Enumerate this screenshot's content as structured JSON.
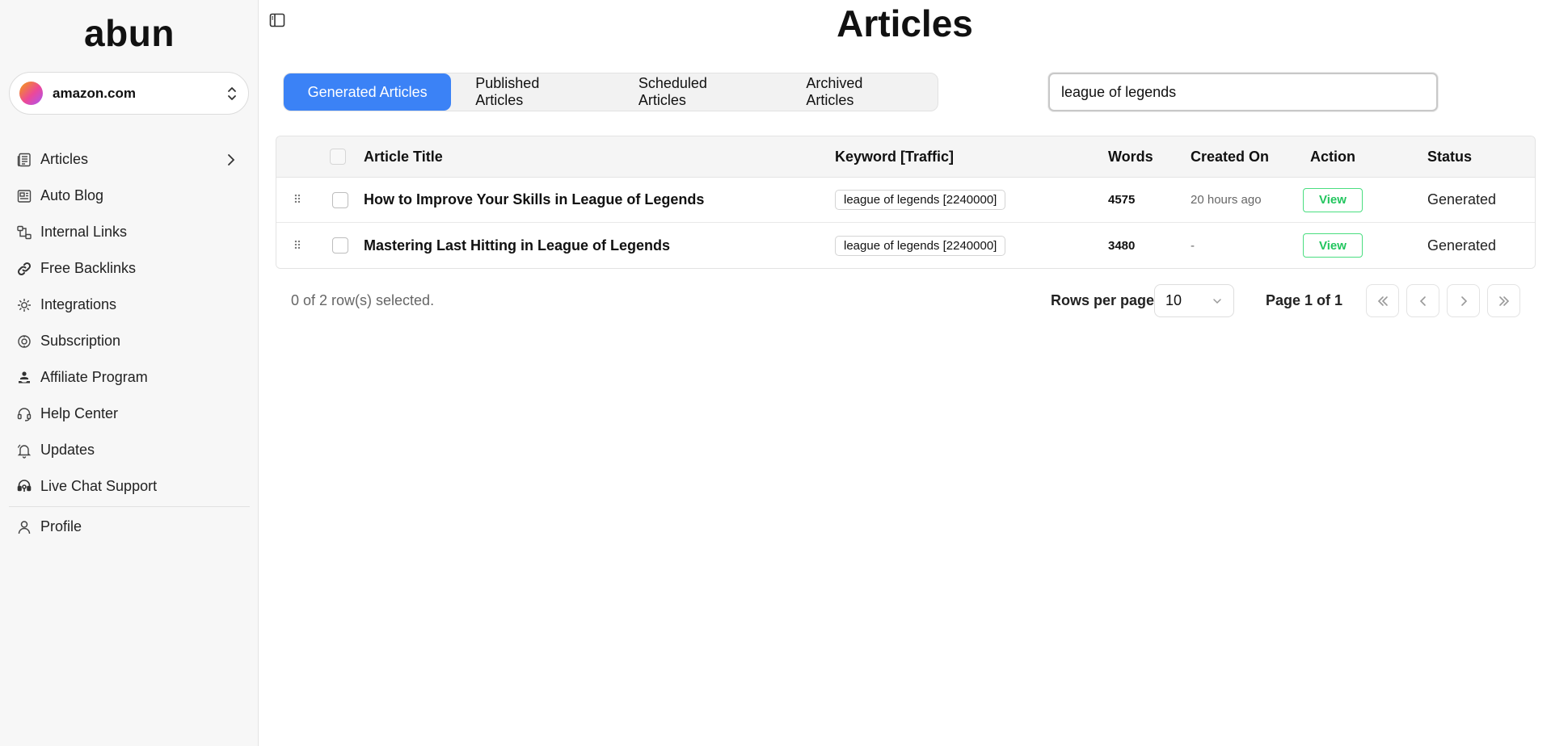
{
  "sidebar": {
    "logo": "abun",
    "site": {
      "name": "amazon.com"
    },
    "items": [
      {
        "label": "Articles",
        "icon": "newspaper-icon",
        "has_chevron": true
      },
      {
        "label": "Auto Blog",
        "icon": "blog-icon"
      },
      {
        "label": "Internal Links",
        "icon": "link-network-icon"
      },
      {
        "label": "Free Backlinks",
        "icon": "link-icon"
      },
      {
        "label": "Integrations",
        "icon": "integrations-icon"
      },
      {
        "label": "Subscription",
        "icon": "subscription-icon"
      },
      {
        "label": "Affiliate Program",
        "icon": "affiliate-icon"
      },
      {
        "label": "Help Center",
        "icon": "headset-icon"
      },
      {
        "label": "Updates",
        "icon": "bell-icon"
      },
      {
        "label": "Live Chat Support",
        "icon": "chat-support-icon"
      }
    ],
    "profile": {
      "label": "Profile",
      "icon": "user-icon"
    }
  },
  "header": {
    "title": "Articles"
  },
  "tabs": [
    {
      "label": "Generated Articles",
      "active": true
    },
    {
      "label": "Published Articles",
      "active": false
    },
    {
      "label": "Scheduled Articles",
      "active": false
    },
    {
      "label": "Archived Articles",
      "active": false
    }
  ],
  "search": {
    "value": "league of legends"
  },
  "table": {
    "columns": {
      "title": "Article Title",
      "keyword": "Keyword [Traffic]",
      "words": "Words",
      "created": "Created On",
      "action": "Action",
      "status": "Status"
    },
    "rows": [
      {
        "title": "How to Improve Your Skills in League of Legends",
        "keyword": "league of legends [2240000]",
        "words": "4575",
        "created": "20 hours ago",
        "action": "View",
        "status": "Generated"
      },
      {
        "title": "Mastering Last Hitting in League of Legends",
        "keyword": "league of legends [2240000]",
        "words": "3480",
        "created": "-",
        "action": "View",
        "status": "Generated"
      }
    ]
  },
  "footer": {
    "selected": "0 of 2 row(s) selected.",
    "rows_per_page_label": "Rows per page",
    "rows_per_page_value": "10",
    "page_info": "Page 1 of 1"
  },
  "colors": {
    "accent": "#3b82f6",
    "view_button": "#22c55e",
    "sidebar_bg": "#f7f7f7"
  }
}
